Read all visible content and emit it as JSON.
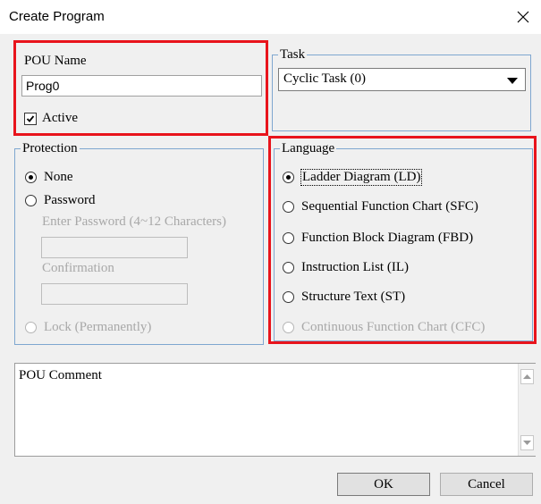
{
  "window": {
    "title": "Create Program"
  },
  "pou": {
    "name_label": "POU Name",
    "name_value": "Prog0",
    "active_label": "Active",
    "active_checked": true
  },
  "task": {
    "legend": "Task",
    "selected": "Cyclic Task (0)"
  },
  "protection": {
    "legend": "Protection",
    "none_label": "None",
    "password_label": "Password",
    "enter_password_label": "Enter Password (4~12 Characters)",
    "confirmation_label": "Confirmation",
    "lock_label": "Lock (Permanently)",
    "selected": "None"
  },
  "language": {
    "legend": "Language",
    "options": [
      "Ladder Diagram (LD)",
      "Sequential Function Chart (SFC)",
      "Function Block Diagram (FBD)",
      "Instruction List (IL)",
      "Structure Text (ST)",
      "Continuous Function Chart (CFC)"
    ],
    "selected": "Ladder Diagram (LD)",
    "disabled": "Continuous Function Chart (CFC)"
  },
  "comment": {
    "text": "POU Comment"
  },
  "buttons": {
    "ok": "OK",
    "cancel": "Cancel"
  },
  "colors": {
    "highlight": "#e8141c",
    "group_border": "#7fa7d0",
    "dialog_bg": "#f0f0f0"
  },
  "icons": {
    "close": "close-icon",
    "check": "checkmark-icon",
    "dropdown": "chevron-down-icon"
  }
}
